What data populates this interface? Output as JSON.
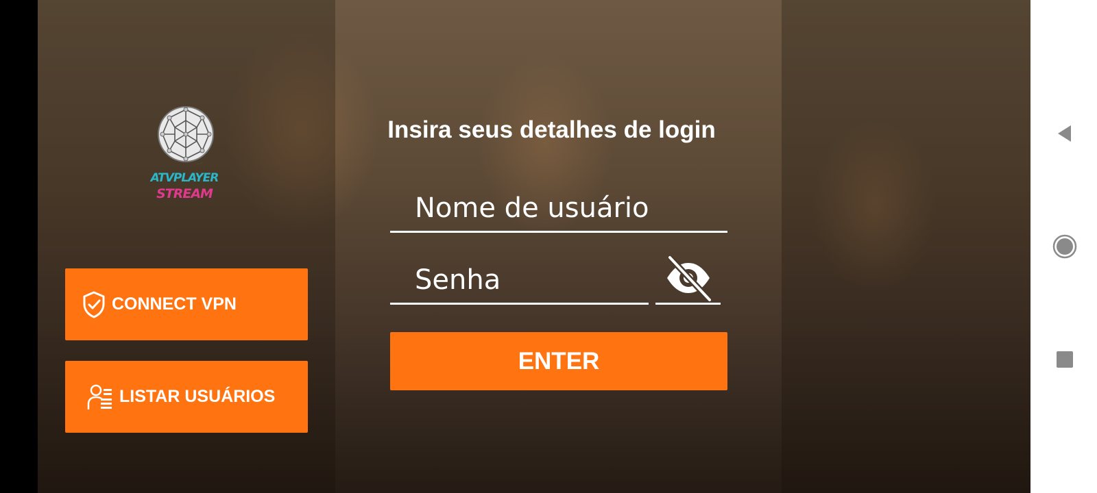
{
  "logo": {
    "line1": "ATVPLAYER",
    "line2": "STREAM"
  },
  "buttons": {
    "connect_vpn": "CONNECT VPN",
    "list_users": "LISTAR USUÁRIOS"
  },
  "login": {
    "title": "Insira seus detalhes de login",
    "username_placeholder": "Nome de usuário",
    "password_placeholder": "Senha",
    "enter_label": "ENTER"
  },
  "colors": {
    "accent": "#ff7411",
    "text": "#ffffff",
    "logo_teal": "#2ab7c9",
    "logo_pink": "#e03a8c"
  },
  "icons": {
    "vpn": "shield-check-icon",
    "users": "user-list-icon",
    "password_toggle": "eye-off-icon",
    "nav_back": "back-triangle-icon",
    "nav_home": "home-circle-icon",
    "nav_recents": "recents-square-icon"
  }
}
